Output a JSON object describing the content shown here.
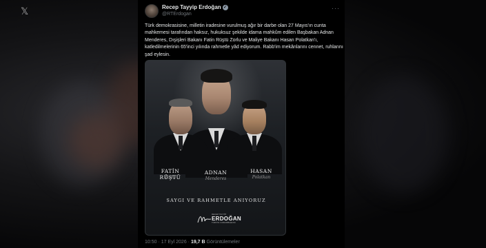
{
  "post": {
    "author_name": "Recep Tayyip Erdoğan",
    "author_handle": "@RTErdogan",
    "text": "Türk demokrasisine, milletin iradesine vurulmuş ağır bir darbe olan 27 Mayıs'ın cunta mahkemesi tarafından haksız, hukuksuz şekilde idama mahkûm edilen Başbakan Adnan Menderes, Dışişleri Bakanı Fatin Rüştü Zorlu ve Maliye Bakanı Hasan Polatkan'ı, katledilmelerinin 65'inci yılında rahmetle yâd ediyorum. Rabb'im mekânlarını cennet, ruhlarını şad eylesin.",
    "time": "10:50 · 17 Eyl 2026",
    "views_count": "19,7 B",
    "views_label": "Görüntülemeler"
  },
  "image": {
    "people": [
      {
        "name": "FATİN RÜŞTÜ",
        "signature": "Zorlu"
      },
      {
        "name": "ADNAN",
        "signature": "Menderes"
      },
      {
        "name": "HASAN",
        "signature": "Polatkan"
      }
    ],
    "motto": "SAYGI VE RAHMETLE ANIYORUZ",
    "seal_top": "RECEP TAYYİP",
    "seal_name": "ERDOĞAN",
    "seal_bottom": "TÜRKİYE CUMHURBAŞKANI"
  },
  "icons": {
    "verified": "verified-badge-icon",
    "more": "more-options-icon",
    "logo": "x-logo-icon"
  },
  "colors": {
    "background": "#000000",
    "text": "#e7e9ea",
    "muted": "#71767b"
  }
}
